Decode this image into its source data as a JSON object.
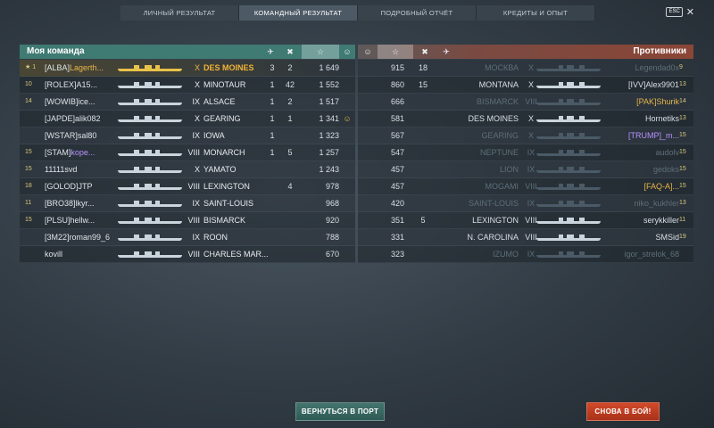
{
  "tabs": [
    {
      "label": "ЛИЧНЫЙ РЕЗУЛЬТАТ",
      "active": false
    },
    {
      "label": "КОМАНДНЫЙ РЕЗУЛЬТАТ",
      "active": true
    },
    {
      "label": "ПОДРОБНЫЙ ОТЧЁТ",
      "active": false
    },
    {
      "label": "КРЕДИТЫ И ОПЫТ",
      "active": false
    }
  ],
  "esc": {
    "key": "ESC",
    "close": "✕"
  },
  "my_team": {
    "title": "Моя команда",
    "columns": {
      "icon_kills_planes": "plane-kill-icon",
      "icon_kills_ships": "ship-kill-icon",
      "icon_xp": "star-icon",
      "icon_medal": "medal-icon"
    },
    "rows": [
      {
        "rank": "★ 1",
        "clan": "[ALBA]",
        "name": "Lagerth...",
        "tier": "X",
        "ship": "DES MOINES",
        "k1": "3",
        "k2": "2",
        "xp": "1 649",
        "medal": "",
        "highlight": true
      },
      {
        "rank": "10",
        "clan": "[ROLEX]",
        "name": "A15...",
        "tier": "X",
        "ship": "MINOTAUR",
        "k1": "1",
        "k2": "42",
        "xp": "1 552",
        "medal": ""
      },
      {
        "rank": "14",
        "clan": "[WOWIB]",
        "name": "ice...",
        "tier": "IX",
        "ship": "ALSACE",
        "k1": "1",
        "k2": "2",
        "xp": "1 517",
        "medal": ""
      },
      {
        "rank": "",
        "clan": "[JAPDE]",
        "name": "alik082",
        "tier": "X",
        "ship": "GEARING",
        "k1": "1",
        "k2": "1",
        "xp": "1 341",
        "medal": "☺"
      },
      {
        "rank": "",
        "clan": "[WSTAR]",
        "name": "sal80",
        "tier": "IX",
        "ship": "IOWA",
        "k1": "1",
        "k2": "",
        "xp": "1 323",
        "medal": ""
      },
      {
        "rank": "15",
        "clan": "[STAM]",
        "name": "kope...",
        "tier": "VIII",
        "ship": "MONARCH",
        "k1": "1",
        "k2": "5",
        "xp": "1 257",
        "medal": ""
      },
      {
        "rank": "15",
        "clan": "",
        "name": "11111svd",
        "tier": "X",
        "ship": "YAMATO",
        "k1": "",
        "k2": "",
        "xp": "1 243",
        "medal": ""
      },
      {
        "rank": "18",
        "clan": "[GOLOD]",
        "name": "JTP",
        "tier": "VIII",
        "ship": "LEXINGTON",
        "k1": "",
        "k2": "4",
        "xp": "978",
        "medal": ""
      },
      {
        "rank": "11",
        "clan": "[BRO38]",
        "name": "lkyr...",
        "tier": "IX",
        "ship": "SAINT-LOUIS",
        "k1": "",
        "k2": "",
        "xp": "968",
        "medal": ""
      },
      {
        "rank": "15",
        "clan": "[PLSU]",
        "name": "hellw...",
        "tier": "VIII",
        "ship": "BISMARCK",
        "k1": "",
        "k2": "",
        "xp": "920",
        "medal": ""
      },
      {
        "rank": "",
        "clan": "[3M22]",
        "name": "roman99_6",
        "tier": "IX",
        "ship": "ROON",
        "k1": "",
        "k2": "",
        "xp": "788",
        "medal": ""
      },
      {
        "rank": "",
        "clan": "",
        "name": "kovill",
        "tier": "VIII",
        "ship": "CHARLES MAR...",
        "k1": "",
        "k2": "",
        "xp": "670",
        "medal": ""
      }
    ]
  },
  "enemy_team": {
    "title": "Противники",
    "columns": {
      "icon_medal": "medal-icon",
      "icon_xp": "star-icon",
      "icon_kills_ships": "ship-kill-icon",
      "icon_kills_planes": "plane-kill-icon"
    },
    "rows": [
      {
        "xp": "915",
        "k1": "18",
        "k2": "",
        "ship": "МОСКВА",
        "tier": "X",
        "player": "Legendad0x",
        "rank": "9",
        "dead": true
      },
      {
        "xp": "860",
        "k1": "15",
        "k2": "",
        "ship": "MONTANA",
        "tier": "X",
        "player": "[IVV]Alex9901",
        "rank": "13",
        "dead": false
      },
      {
        "xp": "666",
        "k1": "",
        "k2": "",
        "ship": "BISMARCK",
        "tier": "VIII",
        "player": "[PAK]Shurik",
        "rank": "14",
        "dead": true
      },
      {
        "xp": "581",
        "k1": "",
        "k2": "",
        "ship": "DES MOINES",
        "tier": "X",
        "player": "Hornetiks",
        "rank": "13",
        "dead": false
      },
      {
        "xp": "567",
        "k1": "",
        "k2": "",
        "ship": "GEARING",
        "tier": "X",
        "player": "[TRUMP]_m...",
        "rank": "15",
        "dead": true
      },
      {
        "xp": "547",
        "k1": "",
        "k2": "",
        "ship": "NEPTUNE",
        "tier": "IX",
        "player": "audolv",
        "rank": "15",
        "dead": true
      },
      {
        "xp": "457",
        "k1": "",
        "k2": "",
        "ship": "LION",
        "tier": "IX",
        "player": "gedoks",
        "rank": "15",
        "dead": true
      },
      {
        "xp": "457",
        "k1": "",
        "k2": "",
        "ship": "MOGAMI",
        "tier": "VIII",
        "player": "[FAQ-A]...",
        "rank": "15",
        "dead": true
      },
      {
        "xp": "420",
        "k1": "",
        "k2": "",
        "ship": "SAINT-LOUIS",
        "tier": "IX",
        "player": "niko_kukhler",
        "rank": "13",
        "dead": true
      },
      {
        "xp": "351",
        "k1": "5",
        "k2": "",
        "ship": "LEXINGTON",
        "tier": "VIII",
        "player": "serykkiller",
        "rank": "11",
        "dead": false
      },
      {
        "xp": "331",
        "k1": "",
        "k2": "",
        "ship": "N. CAROLINA",
        "tier": "VIII",
        "player": "SMSid",
        "rank": "19",
        "dead": false
      },
      {
        "xp": "323",
        "k1": "",
        "k2": "",
        "ship": "IZUMO",
        "tier": "IX",
        "player": "igor_strelok_68",
        "rank": "",
        "dead": true
      }
    ]
  },
  "buttons": {
    "port": "ВЕРНУТЬСЯ В ПОРТ",
    "battle": "СНОВА В БОЙ!"
  }
}
